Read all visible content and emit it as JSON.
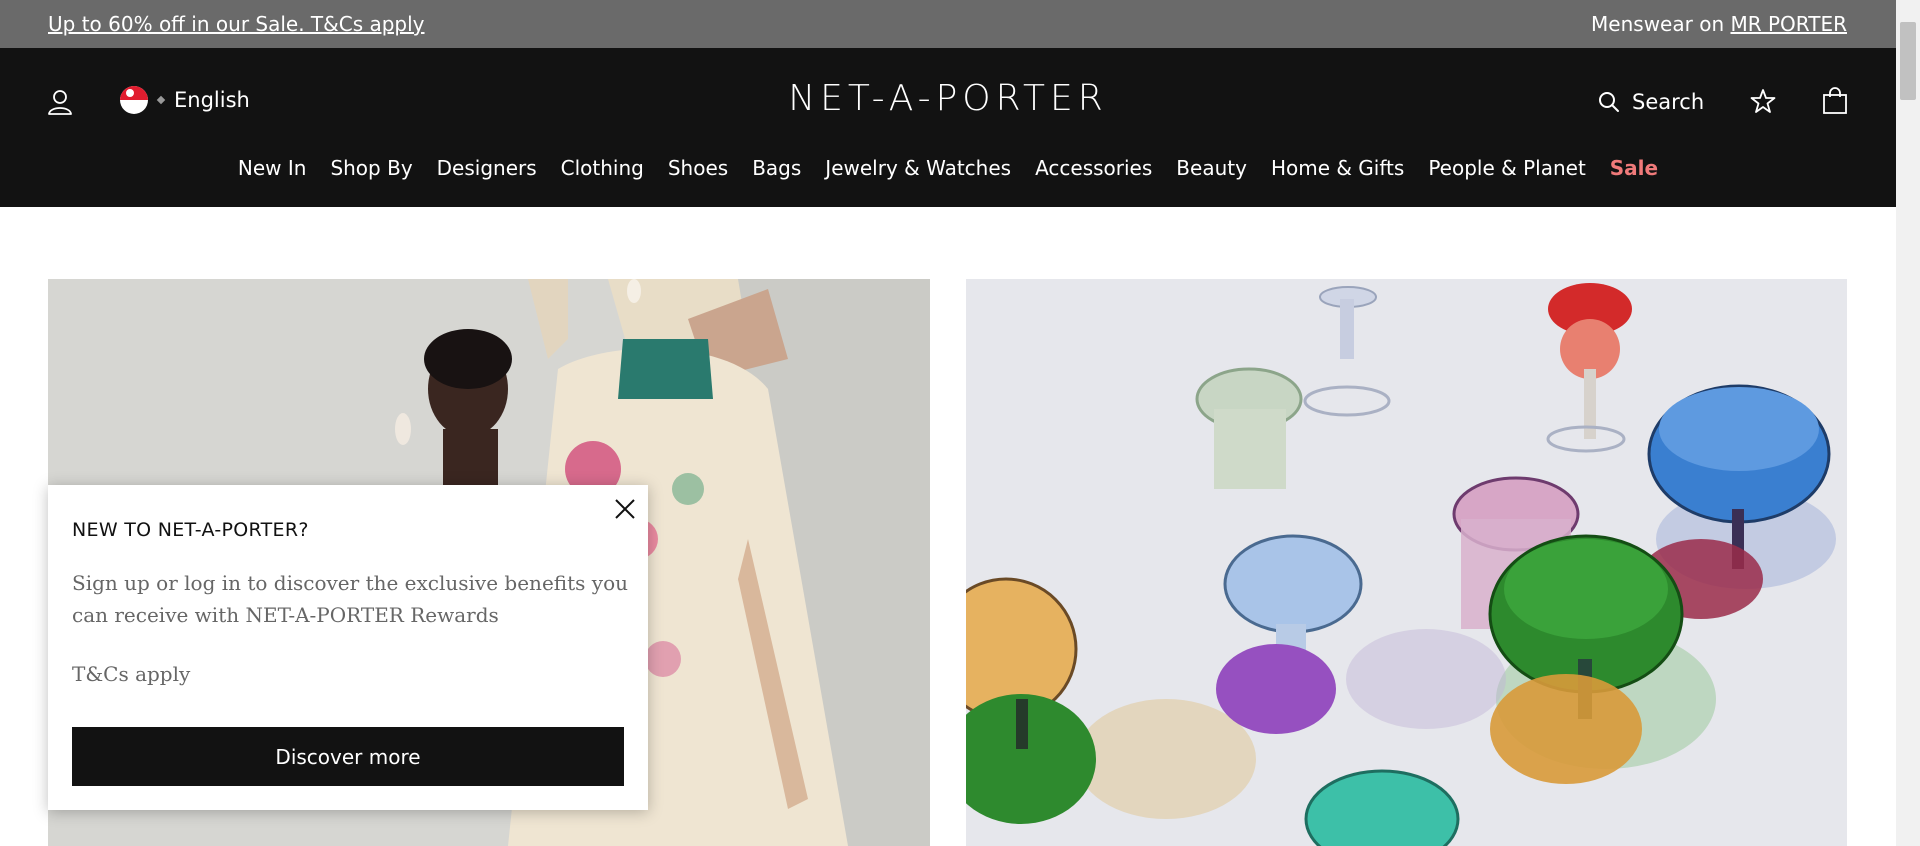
{
  "promo": {
    "sale_text": "Up to 60% off in our Sale. T&Cs apply",
    "menswear_prefix": "Menswear on",
    "menswear_link": "MR PORTER"
  },
  "header": {
    "logo": "NET-A-PORTER",
    "locale": {
      "language": "English",
      "flag_icon": "singapore-flag-icon"
    },
    "search_label": "Search",
    "icons": [
      "account-icon",
      "search-icon",
      "wishlist-star-icon",
      "shopping-bag-icon"
    ]
  },
  "nav": {
    "items": [
      {
        "label": "New In"
      },
      {
        "label": "Shop By"
      },
      {
        "label": "Designers"
      },
      {
        "label": "Clothing"
      },
      {
        "label": "Shoes"
      },
      {
        "label": "Bags"
      },
      {
        "label": "Jewelry & Watches"
      },
      {
        "label": "Accessories"
      },
      {
        "label": "Beauty"
      },
      {
        "label": "Home & Gifts"
      },
      {
        "label": "People & Planet"
      },
      {
        "label": "Sale"
      }
    ],
    "sale_color": "#f07a7a"
  },
  "popup": {
    "title": "NEW TO NET-A-PORTER?",
    "body": "Sign up or log in to discover the exclusive benefits you can receive with NET-A-PORTER Rewards",
    "tcs": "T&Cs apply",
    "button": "Discover more"
  },
  "colors": {
    "promo_bg": "#6a6a6a",
    "header_bg": "#121212",
    "button_bg": "#121212"
  }
}
